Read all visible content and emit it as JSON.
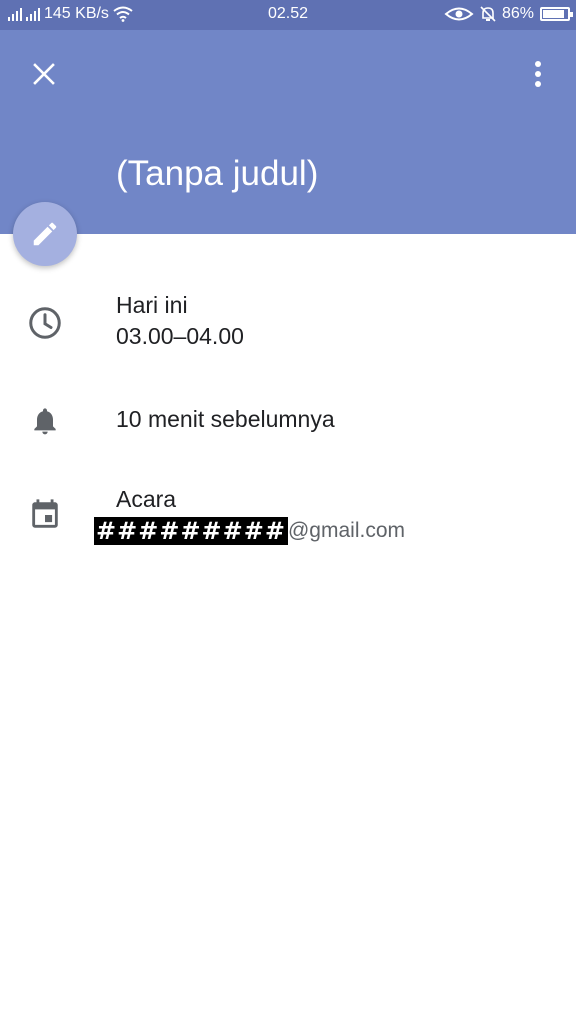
{
  "status_bar": {
    "speed": "145 KB/s",
    "time": "02.52",
    "battery_percent": "86%",
    "battery_level": 0.86
  },
  "app_bar": {
    "title": "(Tanpa judul)",
    "color": "#7186c7",
    "status_color": "#5f71b3"
  },
  "details": {
    "date": "Hari ini",
    "time_range": "03.00–04.00",
    "notification": "10 menit sebelumnya",
    "calendar_name": "Acara",
    "account_redacted": "#########",
    "account_suffix": "@gmail.com"
  },
  "icons": [
    "close-icon",
    "more-vert-icon",
    "edit-icon",
    "clock-icon",
    "bell-icon",
    "calendar-icon"
  ]
}
